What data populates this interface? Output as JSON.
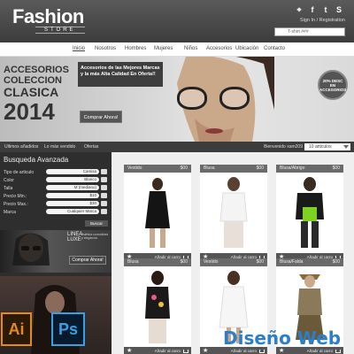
{
  "brand": {
    "name": "Fashion",
    "sub": "STORE"
  },
  "header": {
    "signin": "Sign In / Registration",
    "search_placeholder": "T-shirt ###"
  },
  "nav": {
    "items": [
      "Inicio",
      "Nosotros",
      "Hombres",
      "Mujeres",
      "Niños",
      "Accesorios",
      "Ubicación",
      "Contacto"
    ],
    "active": "Inicio"
  },
  "banner": {
    "line1": "ACCESORIOS",
    "line2": "COLECCION",
    "line3": "CLASICA",
    "line4": "2014",
    "message": "Accesorios de las Mejores Marcas y la más Alta Calidad En Oferta!!",
    "button": "Comprar Ahora!",
    "badge": "20% DESC EN ACCESORIOS"
  },
  "toolbar": {
    "items": [
      "Ultimos añadidos",
      "Lo más vendido",
      "Ofertas"
    ],
    "welcome": "Bienvenido xam209",
    "cart": "10 articulos"
  },
  "sidebar": {
    "title": "Busqueda Avanzada",
    "filters": [
      {
        "label": "Tipo de articulo",
        "value": "Camisa"
      },
      {
        "label": "Color",
        "value": "Blanco"
      },
      {
        "label": "Talla",
        "value": "M (mediano)"
      },
      {
        "label": "Precio Min.:",
        "value": "$10"
      },
      {
        "label": "Precio Max.:",
        "value": "$30"
      },
      {
        "label": "Marca",
        "value": "Cualquier Marca"
      }
    ],
    "search_button": "Buscar",
    "promo": {
      "title1": "LINEA",
      "title2": "LUXE",
      "subtitle": "estética comodidad y elegancia",
      "button": "Comprar Ahora!"
    }
  },
  "products": [
    {
      "category": "Vestido",
      "price": "$00",
      "action": "Añadir al carro"
    },
    {
      "category": "Blusa",
      "price": "$00",
      "action": "Añadir al carro"
    },
    {
      "category": "Blusa/Abrigo",
      "price": "$00",
      "action": "Añadir al carro"
    },
    {
      "category": "Blusa",
      "price": "$00",
      "action": "Añadir al carro"
    },
    {
      "category": "Vestido",
      "price": "$00",
      "action": "Añadir al carro"
    },
    {
      "category": "Blusa/Falda",
      "price": "$00",
      "action": "Añadir al carro"
    }
  ],
  "apps": {
    "illustrator": "Ai",
    "photoshop": "Ps"
  },
  "caption": "Diseño Web",
  "colors": {
    "header": "#3c3c3c",
    "accent": "#2c7ec7",
    "ai": "#e8891d",
    "ps": "#3aa0e6"
  }
}
